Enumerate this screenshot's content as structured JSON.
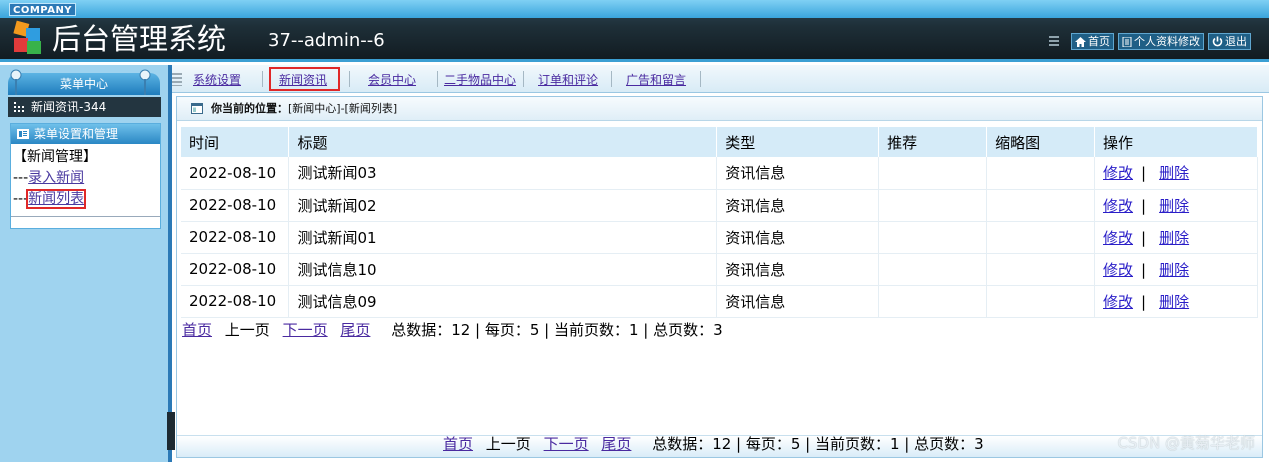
{
  "header": {
    "company": "COMPANY",
    "title": "后台管理系统",
    "user_info": "37--admin--6",
    "links": [
      {
        "icon": "home-icon",
        "label": "首页"
      },
      {
        "icon": "document-icon",
        "label": "个人资料修改"
      },
      {
        "icon": "power-icon",
        "label": "退出"
      }
    ]
  },
  "sidebar": {
    "menu_center": "菜单中心",
    "active_item": "新闻资讯-344",
    "panel_title": "菜单设置和管理",
    "group_title": "【新闻管理】",
    "links": [
      {
        "prefix": "---",
        "label": "录入新闻"
      },
      {
        "prefix": "---",
        "label": "新闻列表"
      }
    ]
  },
  "tabs": [
    "系统设置",
    "新闻资讯",
    "会员中心",
    "二手物品中心",
    "订单和评论",
    "广告和留言"
  ],
  "breadcrumb": {
    "label": "你当前的位置：",
    "path": "[新闻中心]-[新闻列表]"
  },
  "table": {
    "headers": [
      "时间",
      "标题",
      "类型",
      "推荐",
      "缩略图",
      "操作"
    ],
    "rows": [
      {
        "time": "2022-08-10",
        "title": "测试新闻03",
        "type": "资讯信息",
        "recommend": "",
        "thumb": ""
      },
      {
        "time": "2022-08-10",
        "title": "测试新闻02",
        "type": "资讯信息",
        "recommend": "",
        "thumb": ""
      },
      {
        "time": "2022-08-10",
        "title": "测试新闻01",
        "type": "资讯信息",
        "recommend": "",
        "thumb": ""
      },
      {
        "time": "2022-08-10",
        "title": "测试信息10",
        "type": "资讯信息",
        "recommend": "",
        "thumb": ""
      },
      {
        "time": "2022-08-10",
        "title": "测试信息09",
        "type": "资讯信息",
        "recommend": "",
        "thumb": ""
      }
    ],
    "edit_label": "修改",
    "op_separator": "|",
    "delete_label": "删除"
  },
  "pager": {
    "first": "首页",
    "prev": "上一页",
    "next": "下一页",
    "last": "尾页",
    "summary": "总数据：12 | 每页：5 | 当前页数：1 | 总页数：3"
  },
  "watermark": "CSDN @黄菊华老师",
  "colors": {
    "header_dark": "#1e2f38",
    "accent_blue": "#2b79b6",
    "highlight_red": "#e02828",
    "link_purple": "#4a2aa0"
  }
}
